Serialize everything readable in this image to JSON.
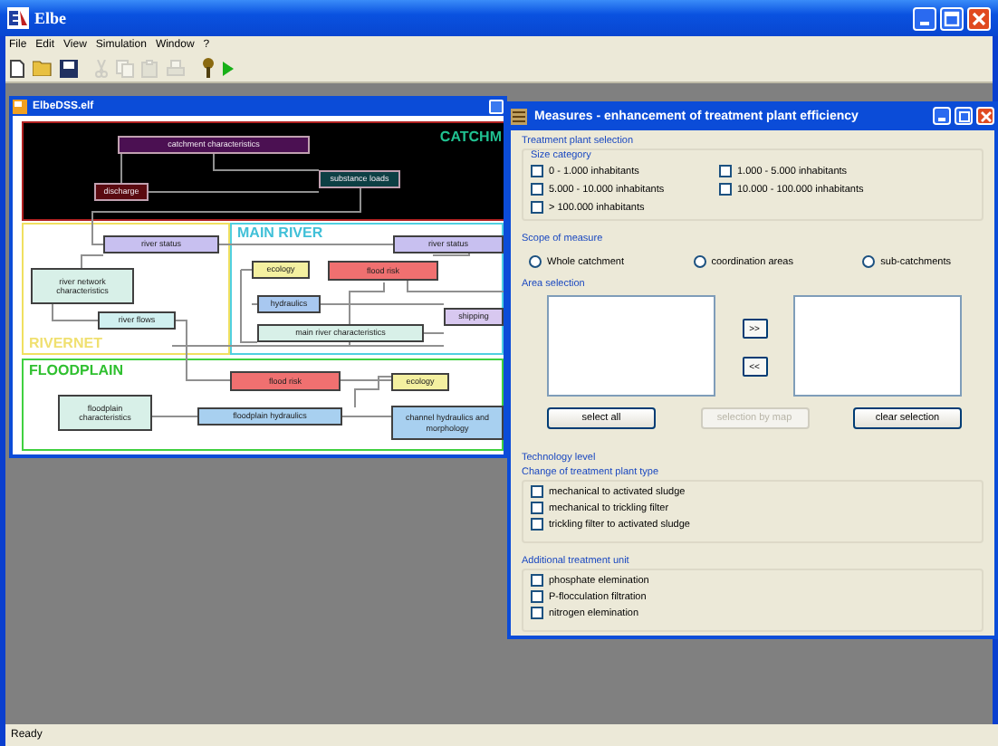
{
  "window": {
    "title": "Elbe"
  },
  "menu": [
    "File",
    "Edit",
    "View",
    "Simulation",
    "Window",
    "?"
  ],
  "toolbar": [
    {
      "kind": "new",
      "disabled": false
    },
    {
      "kind": "open",
      "disabled": false
    },
    {
      "kind": "save",
      "disabled": false
    },
    {
      "kind": "cut",
      "disabled": true
    },
    {
      "kind": "copy",
      "disabled": true
    },
    {
      "kind": "paste",
      "disabled": true
    },
    {
      "kind": "print",
      "disabled": true
    },
    {
      "kind": "pin",
      "disabled": false
    },
    {
      "kind": "run",
      "disabled": false
    }
  ],
  "child_window": {
    "title": "ElbeDSS.elf",
    "regions": [
      {
        "kind": "catchment",
        "label": "CATCHM"
      },
      {
        "kind": "rivernet",
        "label": "RIVERNET"
      },
      {
        "kind": "mainriver",
        "label": "MAIN RIVER"
      },
      {
        "kind": "floodplain",
        "label": "FLOODPLAIN"
      }
    ],
    "nodes": [
      {
        "text": "catchment characteristics",
        "color": "#4b1052"
      },
      {
        "text": "discharge",
        "color": "#5a0a10"
      },
      {
        "text": "substance loads",
        "color": "#0d3f44"
      },
      {
        "text": "river status",
        "color": "#c8c0f0"
      },
      {
        "text": "river network characteristics",
        "color": "#d8f0e8"
      },
      {
        "text": "river flows",
        "color": "#d0f0f0"
      },
      {
        "text": "river status",
        "color": "#c8c0f0"
      },
      {
        "text": "ecology",
        "color": "#f4f0a0"
      },
      {
        "text": "flood risk",
        "color": "#f07070"
      },
      {
        "text": "hydraulics",
        "color": "#a8c8f0"
      },
      {
        "text": "shipping",
        "color": "#d8c8f0"
      },
      {
        "text": "main river characteristics",
        "color": "#d8f0e8"
      },
      {
        "text": "flood risk",
        "color": "#f07070"
      },
      {
        "text": "ecology",
        "color": "#f4f0a0"
      },
      {
        "text": "floodplain characteristics",
        "color": "#d8f0e8"
      },
      {
        "text": "floodplain hydraulics",
        "color": "#a8d0f0"
      },
      {
        "text": "channel hydraulics and morphology",
        "color": "#a8d0f0"
      }
    ]
  },
  "dialog": {
    "title": "Measures - enhancement of treatment plant efficiency",
    "treatment_plant_selection": {
      "label": "Treatment plant selection",
      "size_category": {
        "label": "Size category",
        "options": [
          {
            "label": "0 - 1.000 inhabitants",
            "checked": false
          },
          {
            "label": "1.000 - 5.000 inhabitants",
            "checked": false
          },
          {
            "label": "5.000 - 10.000 inhabitants",
            "checked": false
          },
          {
            "label": "10.000 - 100.000 inhabitants",
            "checked": false
          },
          {
            "label": "> 100.000 inhabitants",
            "checked": false
          }
        ]
      }
    },
    "scope": {
      "label": "Scope of measure",
      "options": [
        {
          "label": "Whole catchment",
          "selected": false
        },
        {
          "label": "coordination areas",
          "selected": false
        },
        {
          "label": "sub-catchments",
          "selected": false
        }
      ]
    },
    "area_selection": {
      "label": "Area selection",
      "add_button": ">>",
      "remove_button": "<<",
      "buttons": [
        {
          "label": "select all",
          "disabled": false
        },
        {
          "label": "selection by map",
          "disabled": true
        },
        {
          "label": "clear selection",
          "disabled": false
        }
      ]
    },
    "technology_level": {
      "label": "Technology level",
      "groups": [
        {
          "label": "Change of treatment plant type",
          "options": [
            {
              "label": "mechanical to activated sludge",
              "checked": false
            },
            {
              "label": "mechanical to trickling filter",
              "checked": false
            },
            {
              "label": "trickling filter to activated sludge",
              "checked": false
            }
          ]
        },
        {
          "label": "Additional treatment unit",
          "options": [
            {
              "label": "phosphate elemination",
              "checked": false
            },
            {
              "label": "P-flocculation filtration",
              "checked": false
            },
            {
              "label": "nitrogen elemination",
              "checked": false
            }
          ]
        }
      ]
    }
  },
  "status_bar": "Ready"
}
